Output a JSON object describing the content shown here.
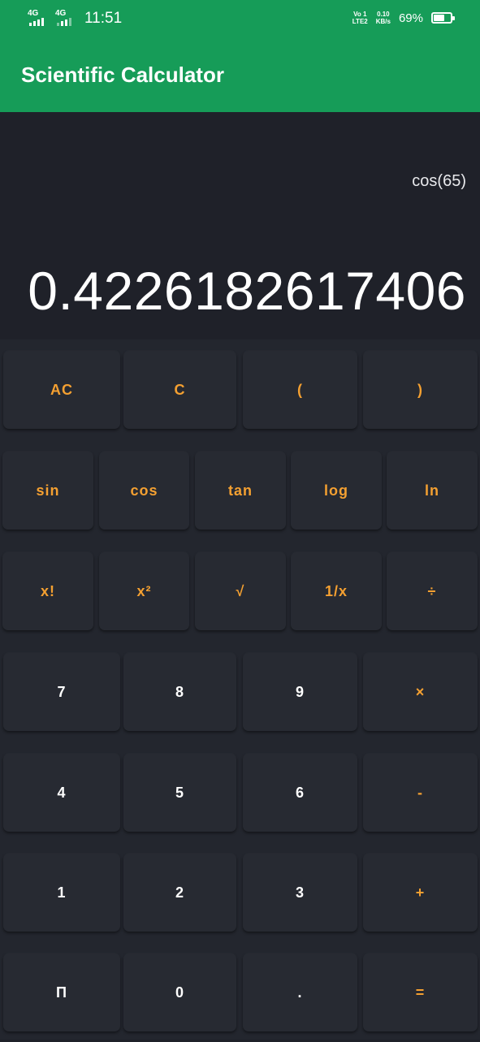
{
  "status_bar": {
    "sim1_network": "4G",
    "sim2_network": "4G",
    "time": "11:51",
    "volte_line1": "Vo 1",
    "volte_line2": "LTE2",
    "speed_value": "0.10",
    "speed_unit": "KB/s",
    "battery_percent": "69%",
    "battery_level": 0.69
  },
  "app_bar": {
    "title": "Scientific Calculator"
  },
  "display": {
    "expression": "cos(65)",
    "result": "0.4226182617406"
  },
  "keypad": {
    "rows": [
      [
        {
          "label": "AC",
          "color": "orange"
        },
        {
          "label": "C",
          "color": "orange"
        },
        {
          "label": "(",
          "color": "orange"
        },
        {
          "label": ")",
          "color": "orange"
        }
      ],
      [
        {
          "label": "sin",
          "color": "orange"
        },
        {
          "label": "cos",
          "color": "orange"
        },
        {
          "label": "tan",
          "color": "orange"
        },
        {
          "label": "log",
          "color": "orange"
        },
        {
          "label": "ln",
          "color": "orange"
        }
      ],
      [
        {
          "label": "x!",
          "color": "orange"
        },
        {
          "label": "x²",
          "color": "orange"
        },
        {
          "label": "√",
          "color": "orange"
        },
        {
          "label": "1/x",
          "color": "orange"
        },
        {
          "label": "÷",
          "color": "orange"
        }
      ],
      [
        {
          "label": "7",
          "color": "white"
        },
        {
          "label": "8",
          "color": "white"
        },
        {
          "label": "9",
          "color": "white"
        },
        {
          "label": "×",
          "color": "orange"
        }
      ],
      [
        {
          "label": "4",
          "color": "white"
        },
        {
          "label": "5",
          "color": "white"
        },
        {
          "label": "6",
          "color": "white"
        },
        {
          "label": "-",
          "color": "orange"
        }
      ],
      [
        {
          "label": "1",
          "color": "white"
        },
        {
          "label": "2",
          "color": "white"
        },
        {
          "label": "3",
          "color": "white"
        },
        {
          "label": "+",
          "color": "orange"
        }
      ],
      [
        {
          "label": "Π",
          "color": "white"
        },
        {
          "label": "0",
          "color": "white"
        },
        {
          "label": ".",
          "color": "white"
        },
        {
          "label": "=",
          "color": "orange"
        }
      ]
    ]
  },
  "colors": {
    "accent_green": "#169c58",
    "key_orange": "#f4a031",
    "background": "#1f2129",
    "key_background": "#272a32"
  }
}
